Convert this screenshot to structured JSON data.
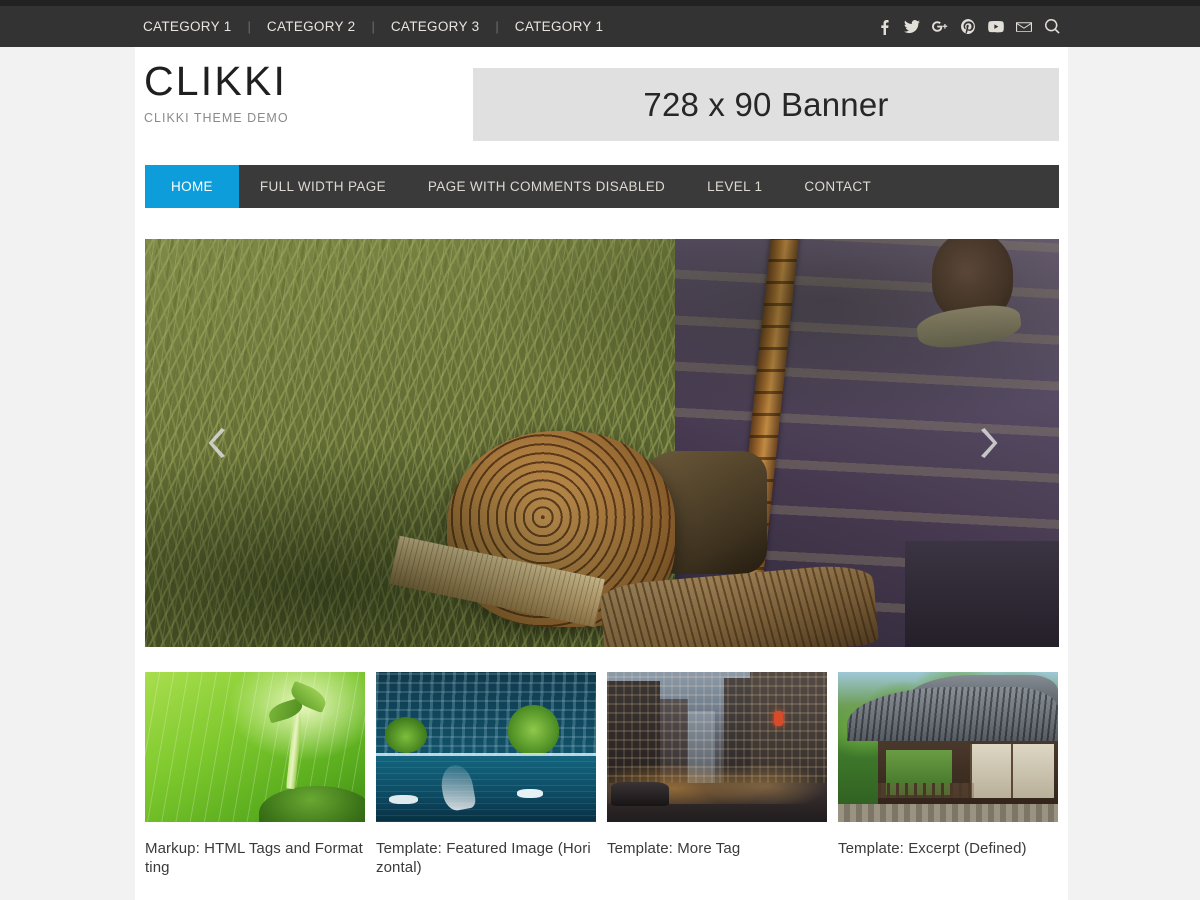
{
  "topbar": {
    "categories": [
      {
        "label": "CATEGORY 1"
      },
      {
        "label": "CATEGORY 2"
      },
      {
        "label": "CATEGORY 3"
      },
      {
        "label": "CATEGORY 1"
      }
    ],
    "separator": "|",
    "social": [
      {
        "name": "facebook-icon",
        "title": "Facebook"
      },
      {
        "name": "twitter-icon",
        "title": "Twitter"
      },
      {
        "name": "google-plus-icon",
        "title": "Google Plus"
      },
      {
        "name": "pinterest-icon",
        "title": "Pinterest"
      },
      {
        "name": "youtube-icon",
        "title": "YouTube"
      },
      {
        "name": "email-icon",
        "title": "Email"
      },
      {
        "name": "search-icon",
        "title": "Search"
      }
    ]
  },
  "header": {
    "logo_title": "CLIKKI",
    "logo_tagline": "CLIKKI THEME DEMO",
    "banner_text": "728 x 90 Banner"
  },
  "mainnav": {
    "items": [
      {
        "label": "HOME",
        "active": true
      },
      {
        "label": "FULL WIDTH PAGE",
        "active": false
      },
      {
        "label": "PAGE WITH COMMENTS DISABLED",
        "active": false
      },
      {
        "label": "LEVEL 1",
        "active": false
      },
      {
        "label": "CONTACT",
        "active": false
      }
    ]
  },
  "slider": {
    "prev_label": "‹",
    "next_label": "›",
    "slide_alt": "Boy in purple striped shirt with cut logs in tall grass"
  },
  "posts": [
    {
      "title": "Markup: HTML Tags and Formatting",
      "thumb_alt": "Green sprout seedling in rain"
    },
    {
      "title": "Template: Featured Image (Horizontal)",
      "thumb_alt": "Lakeside town with flyboarding"
    },
    {
      "title": "Template: More Tag",
      "thumb_alt": "City street at dusk"
    },
    {
      "title": "Template: Excerpt (Defined)",
      "thumb_alt": "Traditional Korean hanok building"
    }
  ],
  "colors": {
    "top_strip": "#222222",
    "topbar": "#333333",
    "nav_bar": "#3a3a3a",
    "accent": "#0d9ddb",
    "page_bg": "#f2f2f2",
    "content_bg": "#ffffff",
    "banner_bg": "#e0e0e0"
  }
}
